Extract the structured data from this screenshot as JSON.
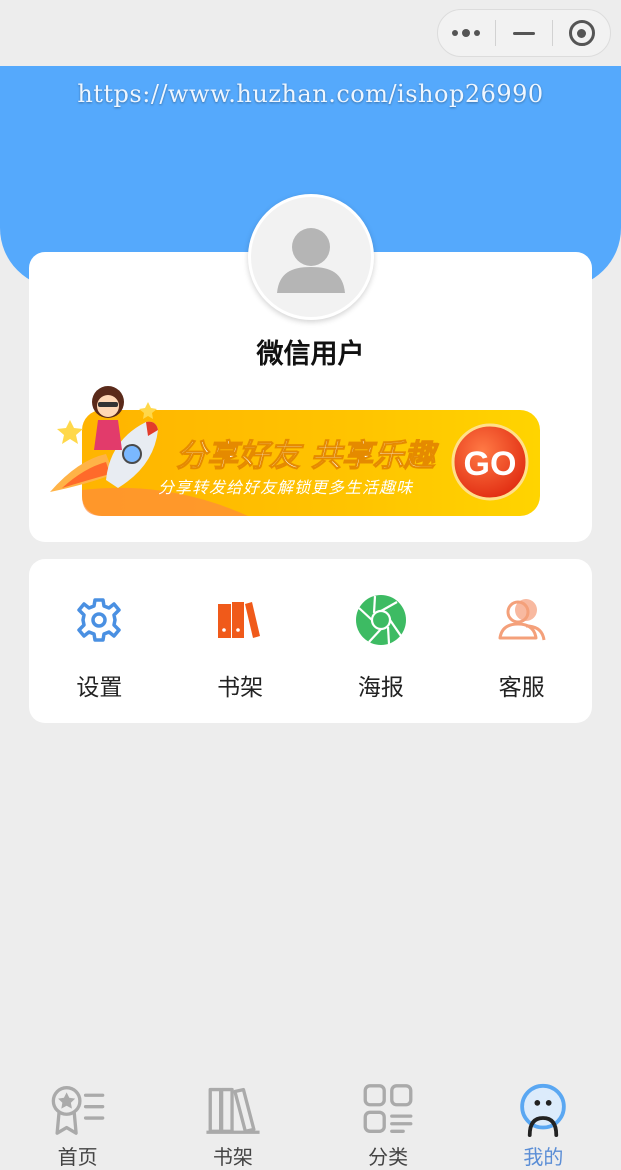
{
  "capsule": {
    "more_icon": "more-dots-icon",
    "minimize_icon": "minimize-icon",
    "close_icon": "target-circle-icon"
  },
  "header": {
    "watermark": "https://www.huzhan.com/ishop26990",
    "color": "#55a9fc"
  },
  "profile": {
    "avatar_icon": "default-user-avatar-icon",
    "nickname": "微信用户"
  },
  "banner": {
    "title": "分享好友 共享乐趣",
    "subtitle": "分享转发给好友解锁更多生活趣味",
    "go_label": "GO"
  },
  "menu": {
    "items": [
      {
        "label": "设置",
        "icon": "gear-icon",
        "color": "#4a90e2"
      },
      {
        "label": "书架",
        "icon": "bookshelf-icon",
        "color": "#f05a1a"
      },
      {
        "label": "海报",
        "icon": "aperture-icon",
        "color": "#3dbb63"
      },
      {
        "label": "客服",
        "icon": "customer-service-icon",
        "color": "#f4a07a"
      }
    ]
  },
  "tabbar": {
    "active_color": "#5b8ed6",
    "items": [
      {
        "label": "首页",
        "icon": "home-badge-icon",
        "active": false
      },
      {
        "label": "书架",
        "icon": "books-icon",
        "active": false
      },
      {
        "label": "分类",
        "icon": "category-grid-icon",
        "active": false
      },
      {
        "label": "我的",
        "icon": "profile-face-icon",
        "active": true
      }
    ]
  }
}
